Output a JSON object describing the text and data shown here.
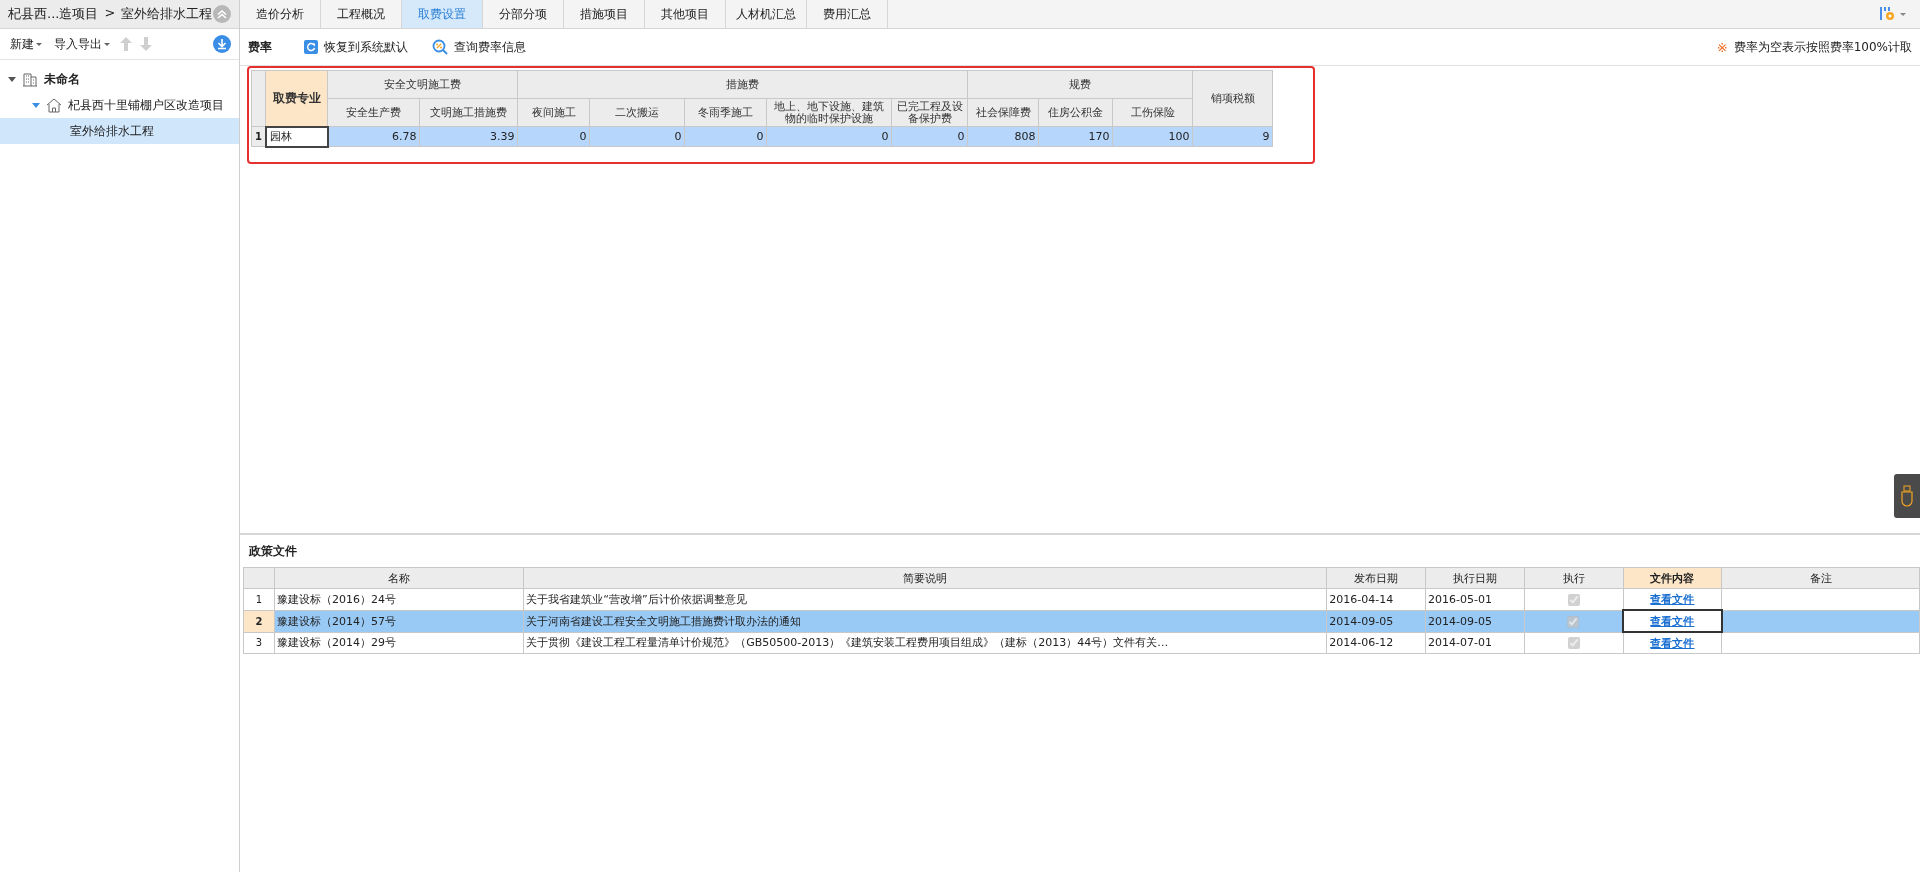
{
  "sidebar": {
    "breadcrumb": {
      "parent": "杞县西...造项目",
      "separator": ">",
      "current": "室外给排水工程"
    },
    "toolbar": [
      {
        "label": "新建",
        "dropdown": true
      },
      {
        "label": "导入导出",
        "dropdown": true
      }
    ],
    "tree": [
      {
        "label": "未命名",
        "kind": "root",
        "expanded": true,
        "selected": false,
        "children": [
          {
            "label": "杞县西十里铺棚户区改造项目",
            "kind": "project",
            "expanded": true,
            "selected": false,
            "children": [
              {
                "label": "室外给排水工程",
                "selected": true
              }
            ]
          }
        ]
      }
    ]
  },
  "tabs": [
    {
      "label": "造价分析",
      "selected": false
    },
    {
      "label": "工程概况",
      "selected": false
    },
    {
      "label": "取费设置",
      "selected": true
    },
    {
      "label": "分部分项",
      "selected": false
    },
    {
      "label": "措施项目",
      "selected": false
    },
    {
      "label": "其他项目",
      "selected": false
    },
    {
      "label": "人材机汇总",
      "selected": false
    },
    {
      "label": "费用汇总",
      "selected": false
    }
  ],
  "fee_toolbar": {
    "title": "费率",
    "buttons": [
      {
        "label": "恢复到系统默认",
        "kind": "restore"
      },
      {
        "label": "查询费率信息",
        "kind": "query"
      }
    ],
    "note_icon": "※",
    "note": "费率为空表示按照费率100%计取"
  },
  "fee_table": {
    "highlighted": true,
    "groups": [
      {
        "label": "取费专业",
        "active": true
      },
      {
        "label": "安全文明施工费",
        "active": false,
        "columns": [
          "安全生产费",
          "文明施工措施费"
        ]
      },
      {
        "label": "措施费",
        "active": false,
        "columns": [
          "夜间施工",
          "二次搬运",
          "冬雨季施工",
          "地上、地下设施、建筑物的临时保护设施",
          "已完工程及设备保护费"
        ]
      },
      {
        "label": "规费",
        "active": false,
        "columns": [
          "社会保障费",
          "住房公积金",
          "工伤保险"
        ]
      },
      {
        "label": "销项税额",
        "active": false
      }
    ],
    "rows": [
      {
        "index": "1",
        "selected": true,
        "cells": [
          "园林",
          "6.78",
          "3.39",
          "0",
          "0",
          "0",
          "0",
          "0",
          "808",
          "170",
          "100",
          "9"
        ]
      }
    ]
  },
  "policy": {
    "title": "政策文件",
    "columns": [
      {
        "label": "名称",
        "active": false
      },
      {
        "label": "简要说明",
        "active": false
      },
      {
        "label": "发布日期",
        "active": false
      },
      {
        "label": "执行日期",
        "active": false
      },
      {
        "label": "执行",
        "active": false
      },
      {
        "label": "文件内容",
        "active": true
      },
      {
        "label": "备注",
        "active": false
      }
    ],
    "rows": [
      {
        "index": "1",
        "selected": false,
        "name": "豫建设标（2016）24号",
        "summary": "关于我省建筑业“营改增”后计价依据调整意见",
        "published": "2016-04-14",
        "effective": "2016-05-01",
        "executed": true,
        "link": "查看文件"
      },
      {
        "index": "2",
        "selected": true,
        "name": "豫建设标（2014）57号",
        "summary": "关于河南省建设工程安全文明施工措施费计取办法的通知",
        "published": "2014-09-05",
        "effective": "2014-09-05",
        "executed": true,
        "link": "查看文件"
      },
      {
        "index": "3",
        "selected": false,
        "name": "豫建设标（2014）29号",
        "summary": "关于贯彻《建设工程工程量清单计价规范》（GB50500-2013）《建筑安装工程费用项目组成》（建标（2013）44号）文件有关…",
        "published": "2014-06-12",
        "effective": "2014-07-01",
        "executed": true,
        "link": "查看文件"
      }
    ]
  }
}
